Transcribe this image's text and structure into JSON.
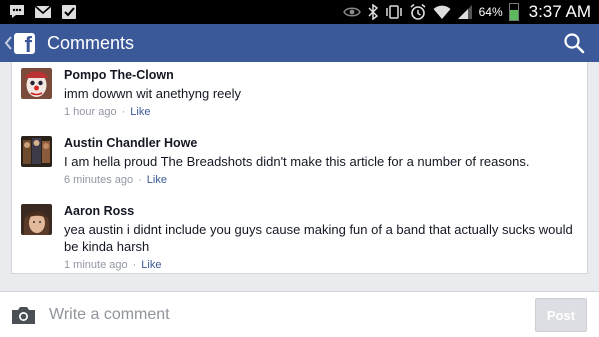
{
  "status_bar": {
    "battery_text": "64%",
    "battery_level": 0.64,
    "time": "3:37 AM",
    "left_icons": [
      "chat-bubble-icon",
      "gmail-icon",
      "checklist-icon"
    ],
    "right_icons": [
      "eye-icon",
      "bluetooth-icon",
      "vibrate-icon",
      "alarm-icon",
      "wifi-icon",
      "signal-icon",
      "battery-icon"
    ]
  },
  "app_bar": {
    "title": "Comments",
    "color": "#3b5998"
  },
  "comments": [
    {
      "name": "Pompo The-Clown",
      "text": "imm dowwn wit anethyng reely",
      "time": "1 hour ago",
      "like_label": "Like"
    },
    {
      "name": "Austin Chandler Howe",
      "text": "I am hella proud The Breadshots didn't make this article for a number of reasons.",
      "time": "6 minutes ago",
      "like_label": "Like"
    },
    {
      "name": "Aaron Ross",
      "text": "yea austin i didnt include you guys cause making fun of a band that actually sucks would be kinda harsh",
      "time": "1 minute ago",
      "like_label": "Like"
    }
  ],
  "meta_separator": "·",
  "composer": {
    "placeholder": "Write a comment",
    "post_label": "Post"
  }
}
